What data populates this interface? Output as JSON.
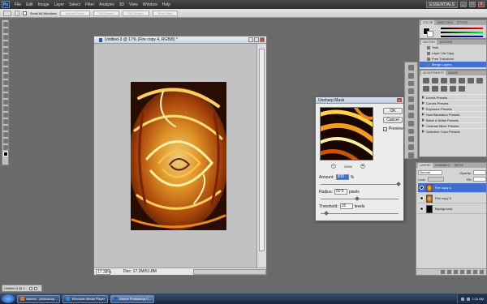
{
  "menubar": {
    "logo": "Ps",
    "items": [
      "File",
      "Edit",
      "Image",
      "Layer",
      "Select",
      "Filter",
      "Analysis",
      "3D",
      "View",
      "Window",
      "Help"
    ],
    "workspace": "ESSENTIALS",
    "buttons": {
      "minimize": "_",
      "maximize": "□",
      "close": "x"
    }
  },
  "options_bar": {
    "scroll_all": "Scroll All Windows",
    "buttons": [
      "Actual Pixels",
      "Fit Screen",
      "Fill Screen",
      "Print Size"
    ]
  },
  "document": {
    "title": "Untitled-3 @ 17% (Fire copy 4, RGB/8) *",
    "zoom": "17.38%",
    "doc_size": "Doc: 17.2M/51.8M"
  },
  "dialog": {
    "title": "Unsharp Mask",
    "close": "x",
    "ok": "OK",
    "cancel": "Cancel",
    "preview_label": "Preview",
    "preview_checked": "✓",
    "zoom_level": "100%",
    "zoom_out": "−",
    "zoom_in": "+",
    "amount_label": "Amount:",
    "amount_value": "500",
    "amount_unit": "%",
    "amount_fraction": 1.0,
    "radius_label": "Radius:",
    "radius_value": "50.5",
    "radius_unit": "pixels",
    "radius_fraction": 0.47,
    "threshold_label": "Threshold:",
    "threshold_value": "15",
    "threshold_unit": "levels",
    "threshold_fraction": 0.07
  },
  "color_panel": {
    "tabs": [
      "COLOR",
      "SWATCHES",
      "STYLES"
    ]
  },
  "history_panel": {
    "tabs": [
      "HISTORY",
      "ACTIONS"
    ],
    "items": [
      {
        "label": "Twirl",
        "selected": false
      },
      {
        "label": "Layer Via Copy",
        "selected": false
      },
      {
        "label": "Free Transform",
        "selected": false
      },
      {
        "label": "Merge Layers",
        "selected": true
      }
    ]
  },
  "adjustments_panel": {
    "tabs": [
      "ADJUSTMENTS",
      "MASKS"
    ],
    "presets": [
      "Levels Presets",
      "Curves Presets",
      "Exposure Presets",
      "Hue/Saturation Presets",
      "Black & White Presets",
      "Channel Mixer Presets",
      "Selective Color Presets"
    ]
  },
  "layers_panel": {
    "tabs": [
      "LAYERS",
      "CHANNELS",
      "PATHS"
    ],
    "blend_mode": "Normal",
    "opacity_label": "Opacity:",
    "lock_label": "Lock:",
    "fill_label": "Fill:",
    "layers": [
      {
        "name": "Fire copy 4",
        "selected": true
      },
      {
        "name": "Fire copy 3",
        "selected": false
      },
      {
        "name": "Background",
        "selected": false
      }
    ]
  },
  "minimized_doc": {
    "title": "Untitled-3 @ 1..."
  },
  "taskbar": {
    "tasks": [
      {
        "label": "wanted - photoshop...",
        "active": false,
        "color": "#e07a1f"
      },
      {
        "label": "Windows Media Player",
        "active": false,
        "color": "#2b8fd6"
      },
      {
        "label": "Adobe Photoshop C...",
        "active": true,
        "color": "#2d5fa8"
      }
    ],
    "clock": "1:11 AM"
  },
  "colors": {
    "selection": "#3f6fcf",
    "fire_dark": "#2a0d02",
    "fire_orange": "#e8871e",
    "fire_yellow": "#ffd24a"
  }
}
